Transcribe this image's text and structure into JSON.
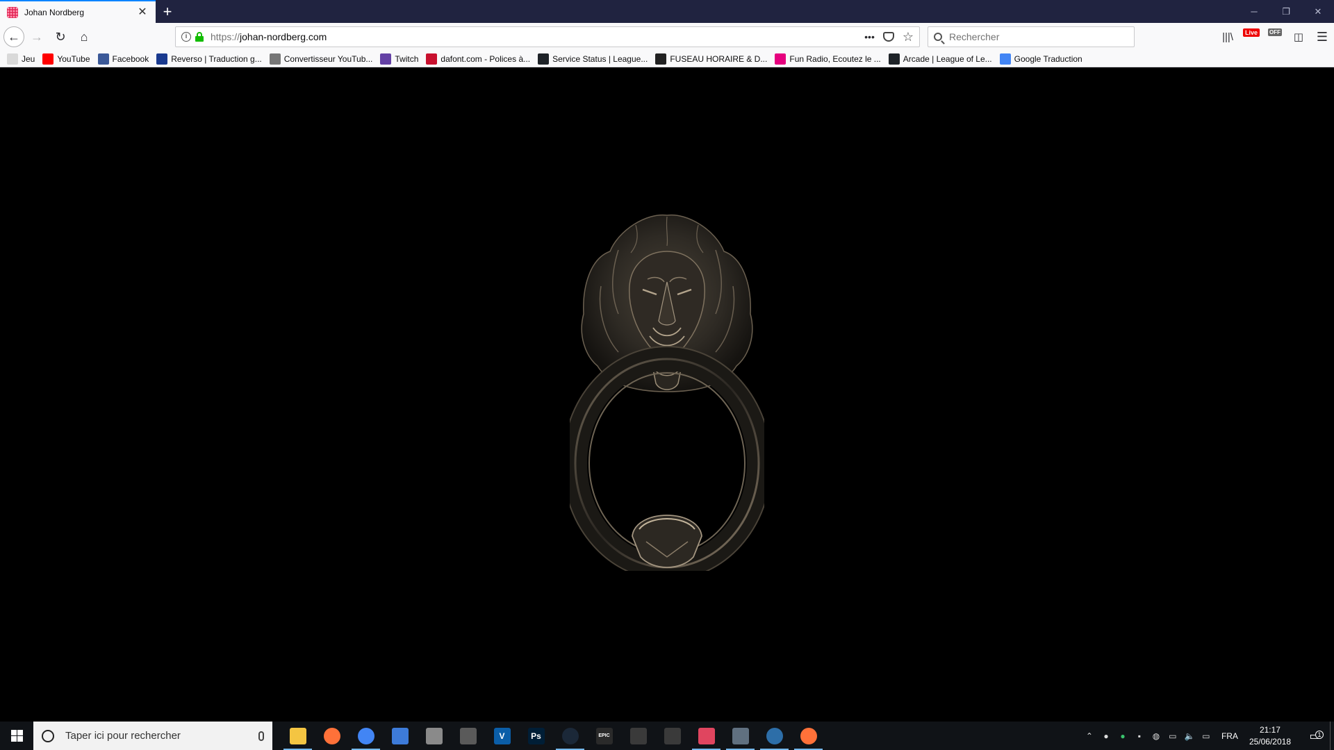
{
  "browser": {
    "tab": {
      "title": "Johan Nordberg",
      "favicon": "johan-nordberg-favicon"
    },
    "window_controls": {
      "minimize": "─",
      "restore": "❐",
      "close": "✕"
    },
    "nav": {
      "back": "←",
      "forward": "→",
      "reload": "↻",
      "home": "⌂"
    },
    "url": {
      "protocol": "https://",
      "host": "johan-nordberg.com"
    },
    "url_actions": {
      "more": "•••",
      "star": "☆"
    },
    "search": {
      "placeholder": "Rechercher"
    },
    "toolbar": {
      "live_badge": "Live",
      "off_badge": "OFF",
      "menu": "☰",
      "library": "|||\\",
      "sidebar": "◫"
    }
  },
  "bookmarks": [
    {
      "label": "Jeu",
      "icon": "folder-icon",
      "color": "#d9d9d9"
    },
    {
      "label": "YouTube",
      "icon": "youtube-icon",
      "color": "#ff0000"
    },
    {
      "label": "Facebook",
      "icon": "facebook-icon",
      "color": "#3b5998"
    },
    {
      "label": "Reverso | Traduction g...",
      "icon": "reverso-icon",
      "color": "#1a3a8f"
    },
    {
      "label": "Convertisseur YouTub...",
      "icon": "converter-icon",
      "color": "#777777"
    },
    {
      "label": "Twitch",
      "icon": "twitch-icon",
      "color": "#6441a5"
    },
    {
      "label": "dafont.com - Polices à...",
      "icon": "dafont-icon",
      "color": "#c8102e"
    },
    {
      "label": "Service Status | League...",
      "icon": "league-icon",
      "color": "#1e2328"
    },
    {
      "label": "FUSEAU HORAIRE & D...",
      "icon": "clock-globe-icon",
      "color": "#222222"
    },
    {
      "label": "Fun Radio, Ecoutez le ...",
      "icon": "funradio-icon",
      "color": "#e6007e"
    },
    {
      "label": "Arcade | League of Le...",
      "icon": "league-icon",
      "color": "#1e2328"
    },
    {
      "label": "Google Traduction",
      "icon": "google-translate-icon",
      "color": "#4285f4"
    }
  ],
  "taskbar": {
    "search_placeholder": "Taper ici pour rechercher",
    "apps": [
      {
        "name": "file-explorer",
        "glyph": "",
        "color": "#f4c542",
        "running": true
      },
      {
        "name": "firefox",
        "glyph": "",
        "color": "#ff7139",
        "running": false
      },
      {
        "name": "chrome",
        "glyph": "",
        "color": "#4285f4",
        "running": true
      },
      {
        "name": "thunderbird",
        "glyph": "",
        "color": "#3d7bd9",
        "running": false
      },
      {
        "name": "app-grid",
        "glyph": "",
        "color": "#8a8a8a",
        "running": false
      },
      {
        "name": "capture-tool",
        "glyph": "",
        "color": "#5a5a5a",
        "running": false
      },
      {
        "name": "vegas",
        "glyph": "V",
        "color": "#0b5ea8",
        "running": false
      },
      {
        "name": "photoshop",
        "glyph": "Ps",
        "color": "#001e36",
        "running": false
      },
      {
        "name": "steam",
        "glyph": "",
        "color": "#1b2838",
        "running": true
      },
      {
        "name": "epic-games",
        "glyph": "EPIC",
        "color": "#2a2a2a",
        "running": false
      },
      {
        "name": "game-app",
        "glyph": "",
        "color": "#3a3a3a",
        "running": false
      },
      {
        "name": "satellite-app",
        "glyph": "",
        "color": "#3a3a3a",
        "running": false
      },
      {
        "name": "discord",
        "glyph": "",
        "color": "#e0455f",
        "running": true
      },
      {
        "name": "printer-app",
        "glyph": "",
        "color": "#607080",
        "running": true
      },
      {
        "name": "network-app",
        "glyph": "",
        "color": "#2d6ea8",
        "running": true
      },
      {
        "name": "firefox-2",
        "glyph": "",
        "color": "#ff7139",
        "running": true
      }
    ],
    "tray": {
      "lang": "FRA",
      "time": "21:17",
      "date": "25/06/2018",
      "notifications": "1"
    }
  },
  "colors": {
    "tab_strip": "#202340",
    "accent": "#0a84ff",
    "lock": "#12bc00",
    "knocker_light": "#8a7c68",
    "knocker_dark": "#2a2620"
  }
}
